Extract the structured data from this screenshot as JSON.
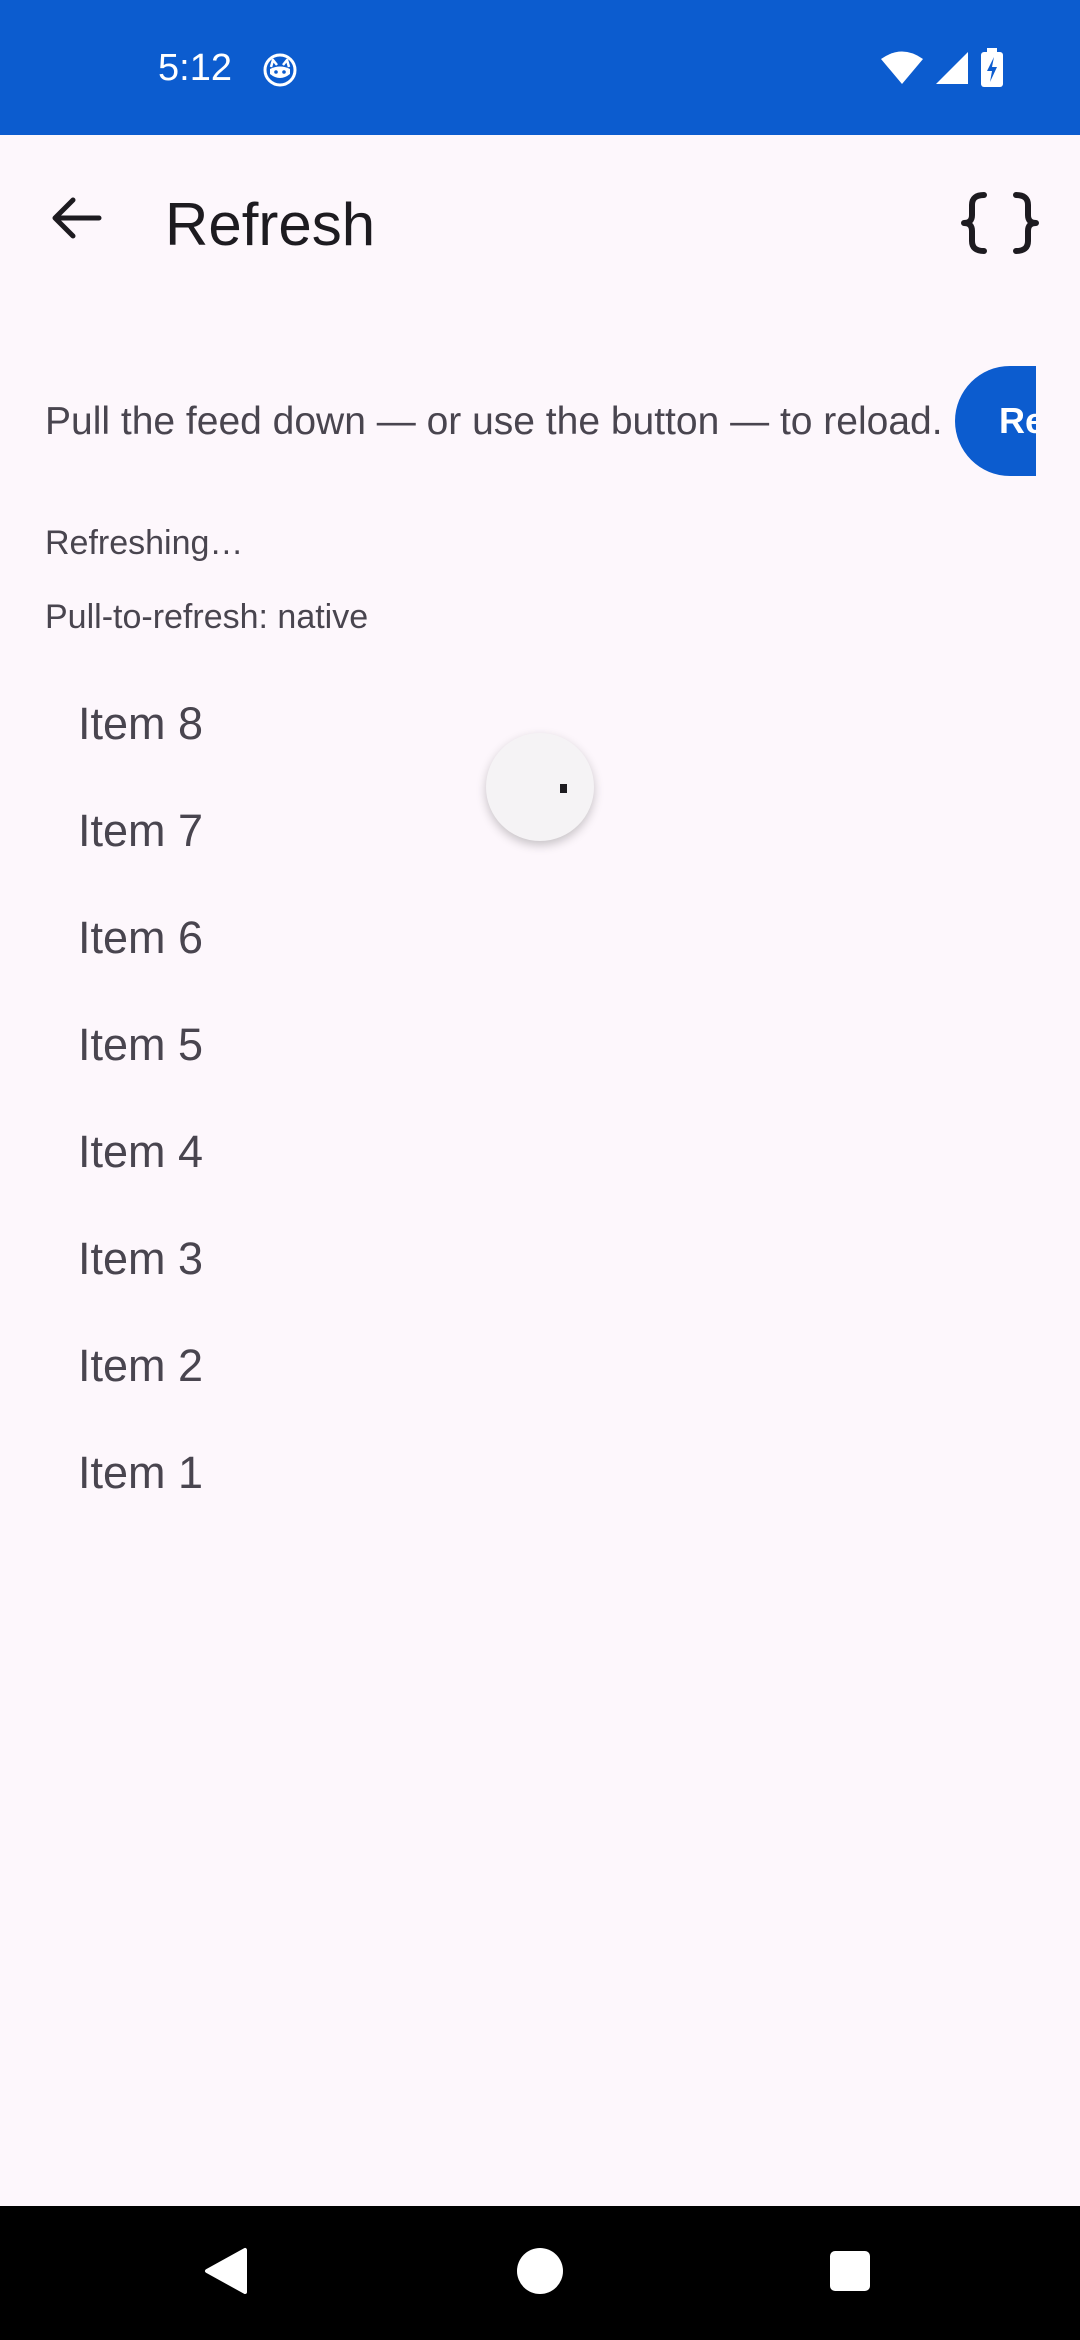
{
  "status_bar": {
    "time": "5:12",
    "app_icon": "cat-face-icon",
    "icons": [
      "wifi-icon",
      "cell-signal-icon",
      "battery-charging-icon"
    ],
    "background_color": "#0c5ccf"
  },
  "app_bar": {
    "back_icon": "arrow-left-icon",
    "title": "Refresh",
    "action_icon": "curly-braces-icon"
  },
  "content": {
    "description": "Pull the feed down — or use the button — to reload.",
    "refresh_button_label": "Refresh",
    "status": "Refreshing…",
    "mode": "Pull-to-refresh: native",
    "items": [
      "Item 8",
      "Item 7",
      "Item 6",
      "Item 5",
      "Item 4",
      "Item 3",
      "Item 2",
      "Item 1"
    ],
    "refreshing": true
  },
  "nav_bar": {
    "buttons": [
      "back-triangle-icon",
      "home-circle-icon",
      "recents-square-icon"
    ]
  },
  "colors": {
    "accent": "#0c5ccf",
    "background": "#fdf7fc",
    "text_primary": "#1d1b20",
    "text_secondary": "#49454f"
  }
}
